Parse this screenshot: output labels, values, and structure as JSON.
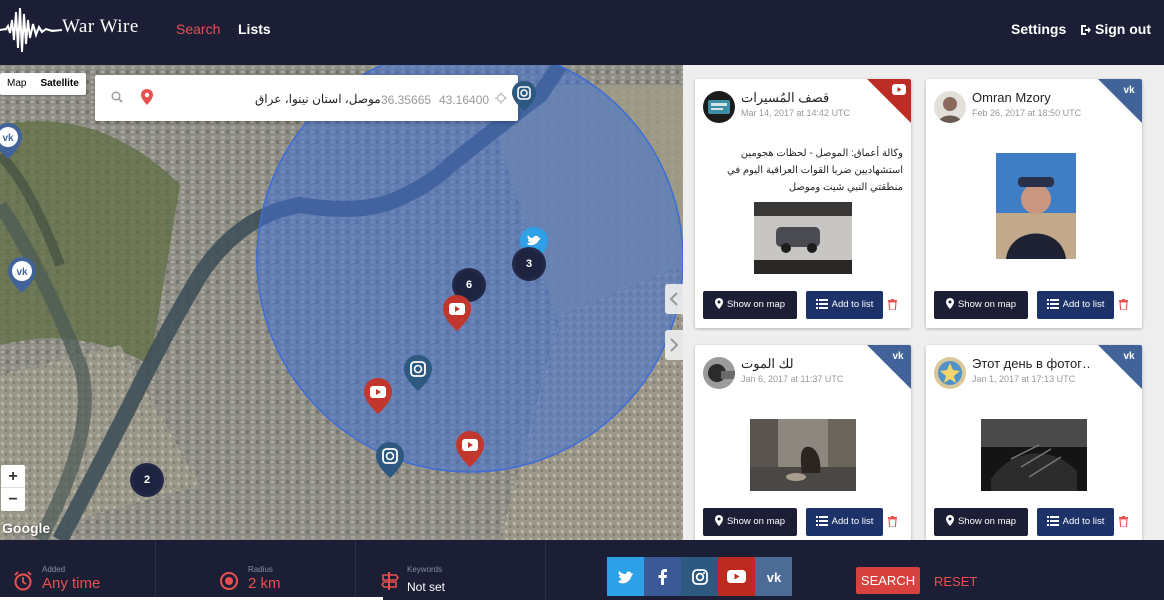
{
  "app": {
    "brand": "War Wire"
  },
  "nav": {
    "search": "Search",
    "lists": "Lists",
    "settings": "Settings",
    "sign_out": "Sign out"
  },
  "map": {
    "type_map": "Map",
    "type_satellite": "Satellite",
    "location": "موصل، استان نینوا، عراق",
    "lat": "36.35665",
    "lng": "43.16400",
    "zoom_in": "+",
    "zoom_out": "−",
    "google": "Google",
    "clusters": [
      "3",
      "6",
      "2"
    ]
  },
  "cards": [
    {
      "name": "قصف المُسيرات",
      "date": "Mar 14, 2017 at 14:42 UTC",
      "network": "youtube",
      "text": "وكالة أعماق: الموصل - لحظات هجومين استشهاديين ضربا القوات العراقية اليوم في منطقتي النبي شيت وموصل"
    },
    {
      "name": "Omran Mzory",
      "date": "Feb 26, 2017 at 18:50 UTC",
      "network": "vk"
    },
    {
      "name": "لك الموت",
      "date": "Jan 6, 2017 at 11:37 UTC",
      "network": "vk"
    },
    {
      "name": "Этот день в фотог…",
      "date": "Jan 1, 2017 at 17:13 UTC",
      "network": "vk"
    }
  ],
  "card_actions": {
    "show_on_map": "Show on map",
    "add_to_list": "Add to list"
  },
  "filters": {
    "added": {
      "label": "Added",
      "value": "Any time"
    },
    "radius": {
      "label": "Radius",
      "value": "2 km"
    },
    "keywords": {
      "label": "Keywords",
      "value": "Not set"
    }
  },
  "socials": [
    {
      "name": "twitter",
      "color": "#2ea0e7"
    },
    {
      "name": "facebook",
      "color": "#3b5a95"
    },
    {
      "name": "instagram",
      "color": "#2d5880"
    },
    {
      "name": "youtube",
      "color": "#bc2a20"
    },
    {
      "name": "vk",
      "color": "#4c6b95"
    }
  ],
  "actions": {
    "search": "SEARCH",
    "reset": "RESET"
  },
  "colors": {
    "accent": "#e8514f",
    "navy": "#1b1e34",
    "vk": "#41639a",
    "youtube": "#bb2d25"
  }
}
